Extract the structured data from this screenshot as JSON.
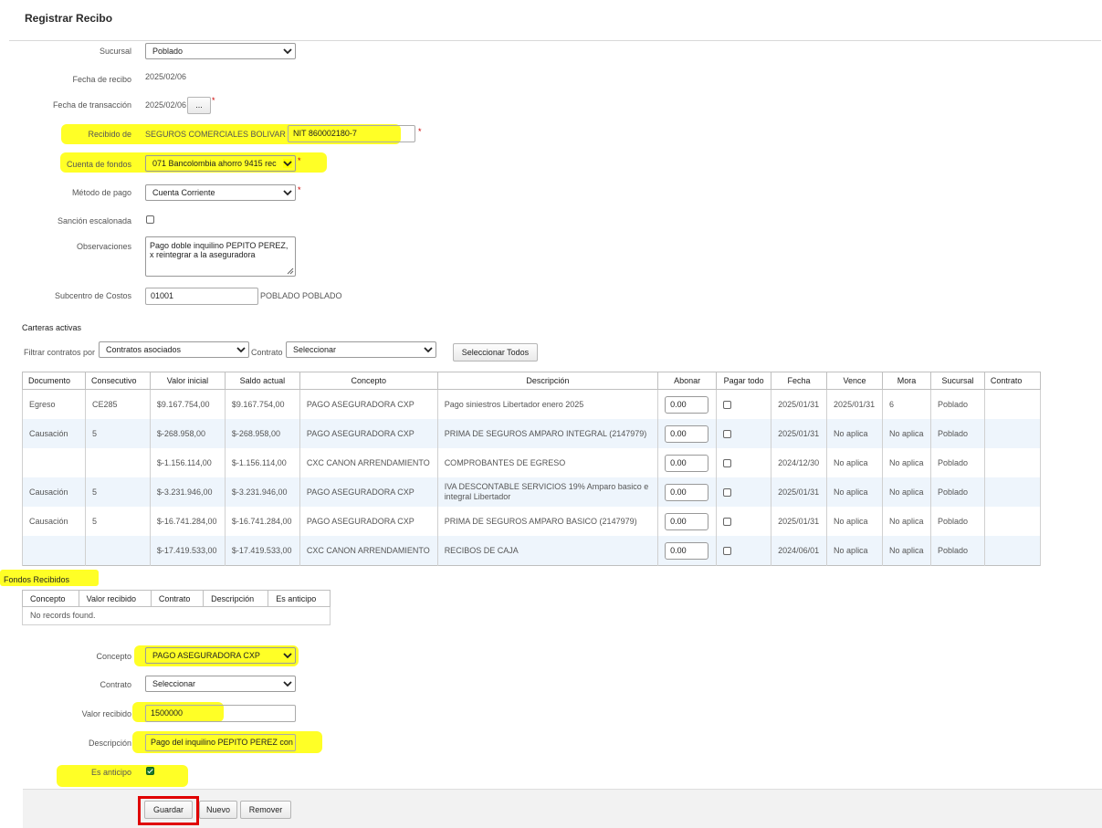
{
  "page": {
    "title": "Registrar Recibo"
  },
  "form": {
    "sucursal": {
      "label": "Sucursal",
      "value": "Poblado"
    },
    "fecha_recibo": {
      "label": "Fecha de recibo",
      "value": "2025/02/06"
    },
    "fecha_transaccion": {
      "label": "Fecha de transacción",
      "value": "2025/02/06",
      "button": "..."
    },
    "recibido_de": {
      "label": "Recibido de",
      "value": "SEGUROS COMERCIALES BOLIVAR",
      "nit": "NIT 860002180-7"
    },
    "cuenta_fondos": {
      "label": "Cuenta de fondos",
      "value": "071 Bancolombia ahorro 9415 rec"
    },
    "metodo_pago": {
      "label": "Método de pago",
      "value": "Cuenta Corriente"
    },
    "sancion": {
      "label": "Sanción escalonada"
    },
    "observaciones": {
      "label": "Observaciones",
      "line1": "Pago doble inquilino PEPITO PEREZ,",
      "line2": "x reintegrar a la aseguradora"
    },
    "subcentro": {
      "label": "Subcentro de Costos",
      "value": "01001",
      "desc": "POBLADO POBLADO"
    },
    "required_mark": "*"
  },
  "carteras": {
    "title": "Carteras activas",
    "filter_label": "Filtrar contratos por",
    "filter_value": "Contratos asociados",
    "contrato_label": "Contrato",
    "contrato_value": "Seleccionar",
    "select_all": "Seleccionar Todos",
    "columns": [
      "Documento",
      "Consecutivo",
      "Valor inicial",
      "Saldo actual",
      "Concepto",
      "Descripción",
      "Abonar",
      "Pagar todo",
      "Fecha",
      "Vence",
      "Mora",
      "Sucursal",
      "Contrato"
    ],
    "rows": [
      {
        "doc": "Egreso",
        "cons": "CE285",
        "vi": "$9.167.754,00",
        "sa": "$9.167.754,00",
        "concepto": "PAGO ASEGURADORA CXP",
        "desc": "Pago siniestros Libertador enero 2025",
        "abonar": "0.00",
        "fecha": "2025/01/31",
        "vence": "2025/01/31",
        "mora": "6",
        "suc": "Poblado"
      },
      {
        "doc": "Causación",
        "cons": "5",
        "vi": "$-268.958,00",
        "sa": "$-268.958,00",
        "concepto": "PAGO ASEGURADORA CXP",
        "desc": "PRIMA DE SEGUROS AMPARO INTEGRAL (2147979)",
        "abonar": "0.00",
        "fecha": "2025/01/31",
        "vence": "No aplica",
        "mora": "No aplica",
        "suc": "Poblado"
      },
      {
        "doc": "",
        "cons": "",
        "vi": "$-1.156.114,00",
        "sa": "$-1.156.114,00",
        "concepto": "CXC CANON ARRENDAMIENTO",
        "desc": "COMPROBANTES DE EGRESO",
        "abonar": "0.00",
        "fecha": "2024/12/30",
        "vence": "No aplica",
        "mora": "No aplica",
        "suc": "Poblado"
      },
      {
        "doc": "Causación",
        "cons": "5",
        "vi": "$-3.231.946,00",
        "sa": "$-3.231.946,00",
        "concepto": "PAGO ASEGURADORA CXP",
        "desc": "IVA DESCONTABLE SERVICIOS 19% Amparo basico e integral Libertador",
        "abonar": "0.00",
        "fecha": "2025/01/31",
        "vence": "No aplica",
        "mora": "No aplica",
        "suc": "Poblado"
      },
      {
        "doc": "Causación",
        "cons": "5",
        "vi": "$-16.741.284,00",
        "sa": "$-16.741.284,00",
        "concepto": "PAGO ASEGURADORA CXP",
        "desc": "PRIMA DE SEGUROS AMPARO BASICO (2147979)",
        "abonar": "0.00",
        "fecha": "2025/01/31",
        "vence": "No aplica",
        "mora": "No aplica",
        "suc": "Poblado"
      },
      {
        "doc": "",
        "cons": "",
        "vi": "$-17.419.533,00",
        "sa": "$-17.419.533,00",
        "concepto": "CXC CANON ARRENDAMIENTO",
        "desc": "RECIBOS DE CAJA",
        "abonar": "0.00",
        "fecha": "2024/06/01",
        "vence": "No aplica",
        "mora": "No aplica",
        "suc": "Poblado"
      }
    ]
  },
  "fondos": {
    "title": "Fondos Recibidos",
    "columns": [
      "Concepto",
      "Valor recibido",
      "Contrato",
      "Descripción",
      "Es anticipo"
    ],
    "empty": "No records found.",
    "concepto": {
      "label": "Concepto",
      "value": "PAGO ASEGURADORA CXP"
    },
    "contrato": {
      "label": "Contrato",
      "value": "Seleccionar"
    },
    "valor": {
      "label": "Valor recibido",
      "value": "1500000"
    },
    "descripcion": {
      "label": "Descripción",
      "value": "Pago del inquilino PEPITO PEREZ con"
    },
    "anticipo": {
      "label": "Es anticipo",
      "checked": true
    }
  },
  "actions": {
    "guardar": "Guardar",
    "nuevo": "Nuevo",
    "remover": "Remover"
  },
  "colors": {
    "highlight": "#ffff00",
    "required": "#cc0000",
    "alt_row": "#eef5fc",
    "checked": "#1a7a2c",
    "focus_box": "#e00000"
  }
}
